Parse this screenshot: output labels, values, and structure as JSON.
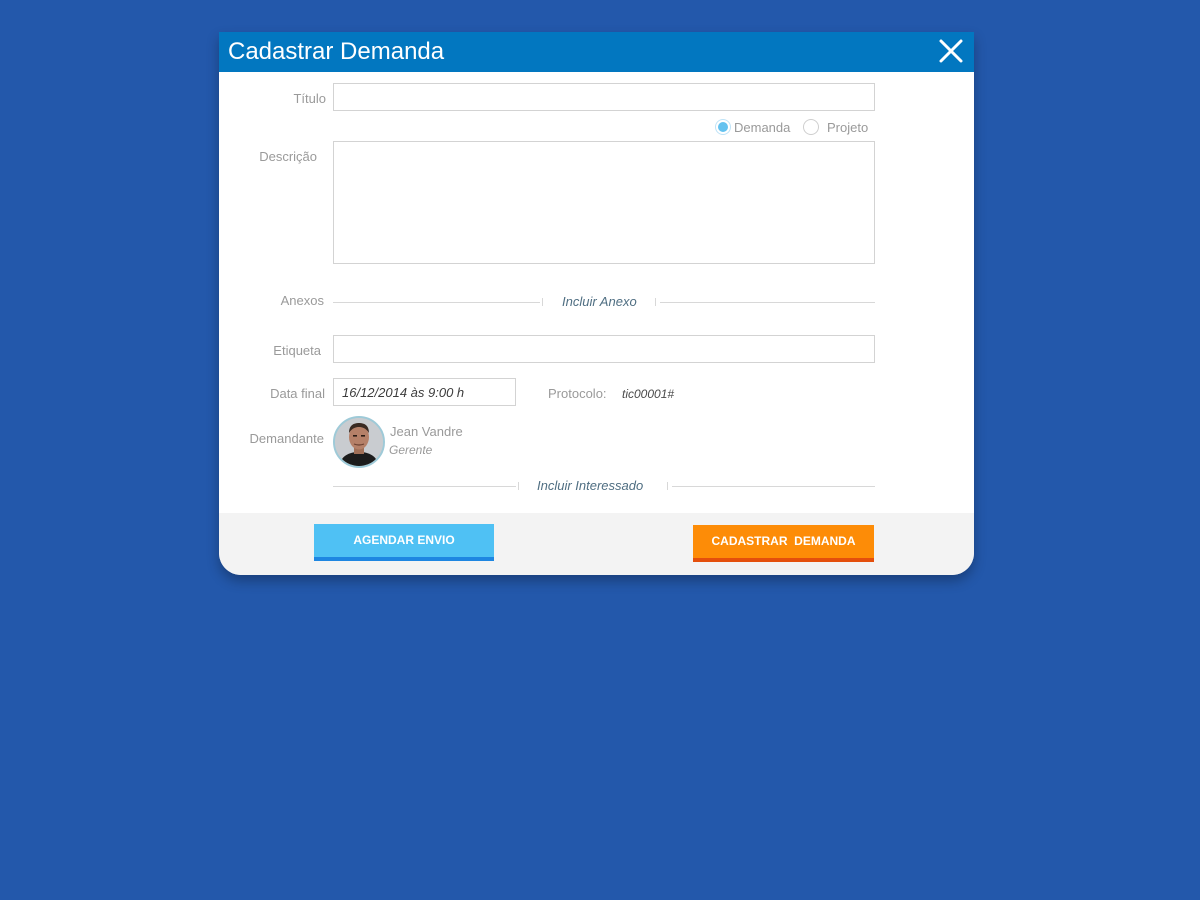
{
  "modal": {
    "title": "Cadastrar Demanda",
    "close_icon": "close-icon"
  },
  "form": {
    "titulo_label": "Título",
    "titulo_value": "",
    "tipo": {
      "options": [
        "Demanda",
        "Projeto"
      ],
      "selected": "Demanda"
    },
    "descricao_label": "Descrição",
    "descricao_value": "",
    "anexos_label": "Anexos",
    "incluir_anexo": "Incluir Anexo",
    "etiqueta_label": "Etiqueta",
    "etiqueta_value": "",
    "data_final_label": "Data final",
    "data_final_value": "16/12/2014 às 9:00 h",
    "protocolo_label": "Protocolo:",
    "protocolo_value": "tic00001#",
    "demandante_label": "Demandante",
    "demandante": {
      "name": "Jean Vandre",
      "role": "Gerente"
    },
    "incluir_interessado": "Incluir Interessado"
  },
  "footer": {
    "agendar_label": "AGENDAR ENVIO",
    "cadastrar_label": "CADASTRAR  DEMANDA"
  },
  "colors": {
    "background": "#2358ab",
    "header": "#0277c0",
    "agendar_button": "#4fc1f4",
    "cadastrar_button": "#fd8c07"
  }
}
